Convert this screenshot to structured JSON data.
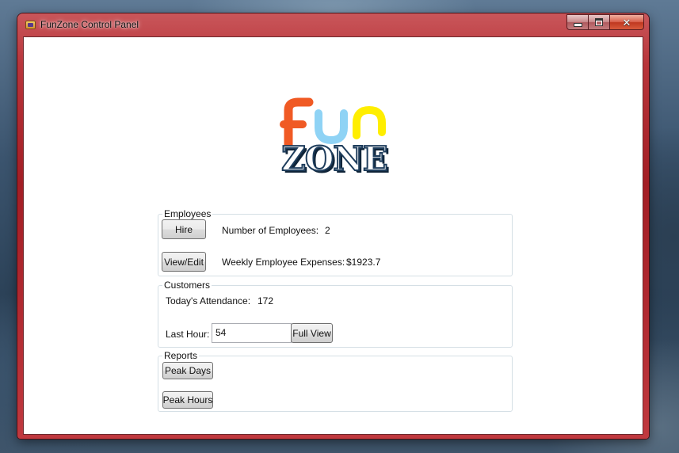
{
  "window": {
    "title": "FunZone Control Panel",
    "icon": "app-icon",
    "controls": {
      "minimize": "minimize-icon",
      "maximize": "maximize-icon",
      "close": "close-icon"
    }
  },
  "logo": {
    "top_text": "Fun",
    "bottom_text": "ZONE"
  },
  "employees": {
    "legend": "Employees",
    "hire_label": "Hire",
    "view_edit_label": "View/Edit",
    "count_label": "Number of Employees:",
    "count_value": "2",
    "expenses_label": "Weekly Employee Expenses:",
    "expenses_value": "$1923.7"
  },
  "customers": {
    "legend": "Customers",
    "attendance_label": "Today's Attendance:",
    "attendance_value": "172",
    "last_hour_label": "Last Hour:",
    "last_hour_value": "54",
    "full_view_label": "Full View"
  },
  "reports": {
    "legend": "Reports",
    "peak_days_label": "Peak Days",
    "peak_hours_label": "Peak Hours"
  },
  "colors": {
    "titlebar": "#a31e25",
    "logo_f": "#f05a24",
    "logo_u": "#8fd3f5",
    "logo_n": "#ffee00",
    "logo_zone": "#1e3d5c"
  }
}
